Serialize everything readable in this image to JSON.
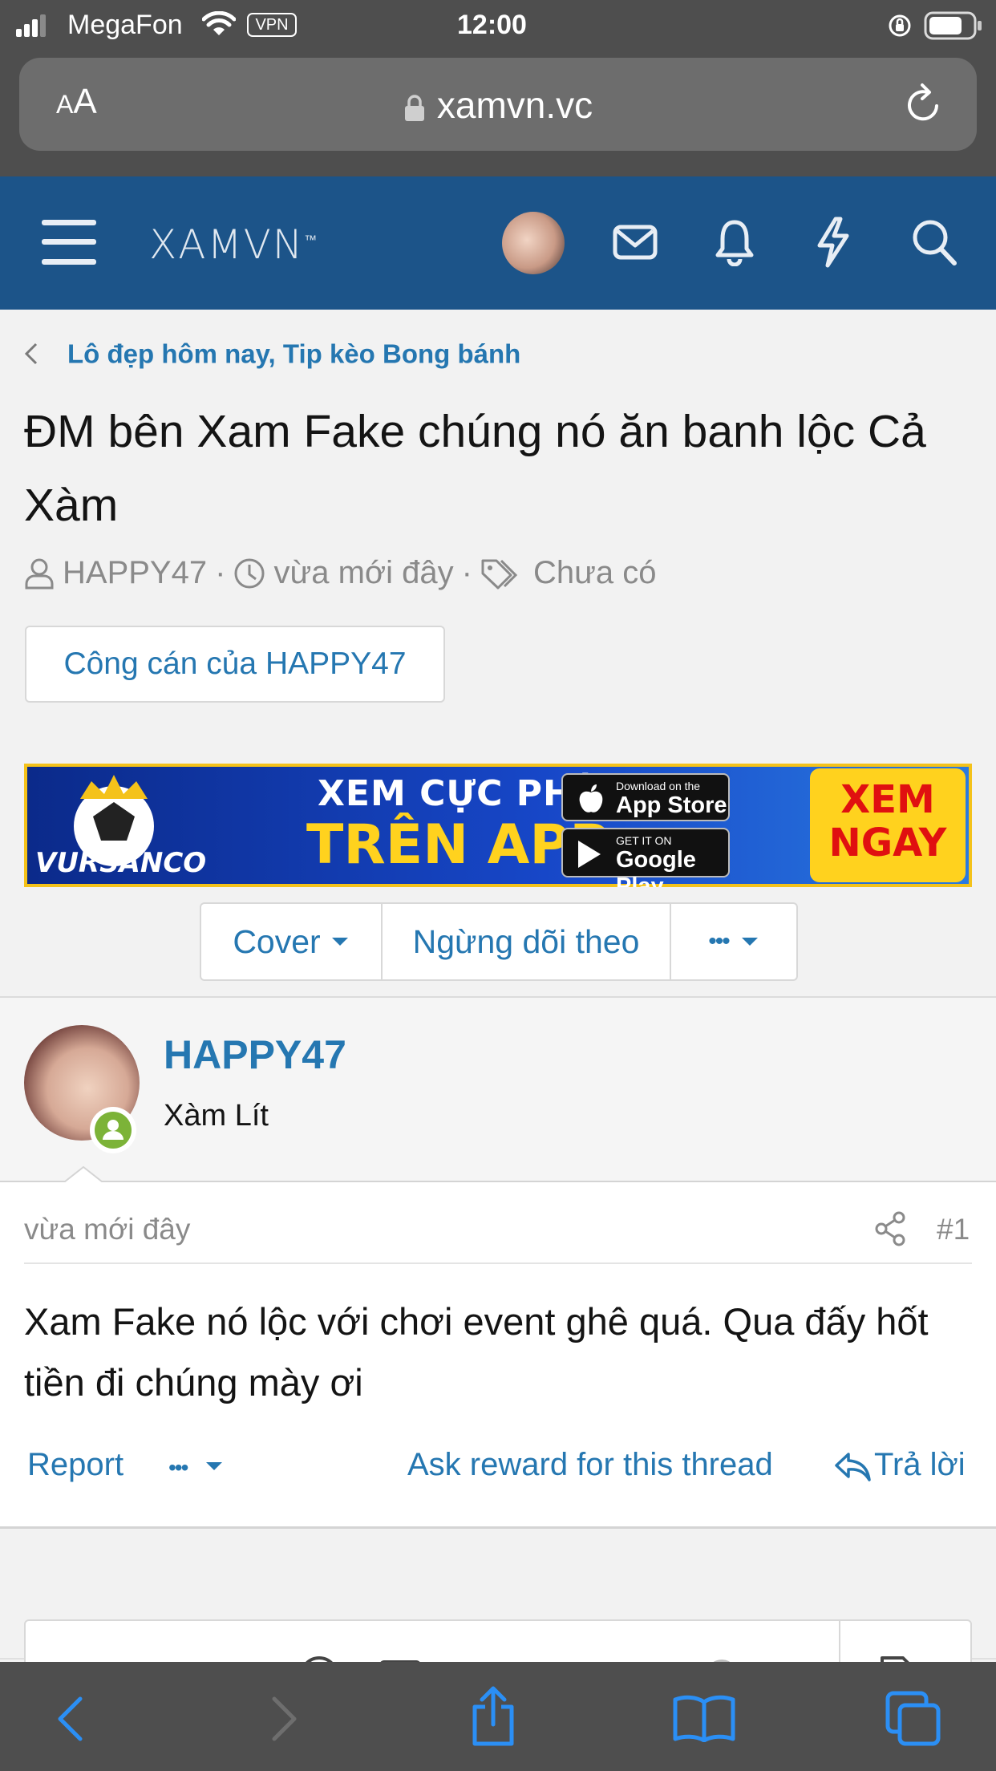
{
  "status_bar": {
    "carrier": "MegaFon",
    "vpn": "VPN",
    "time": "12:00"
  },
  "browser": {
    "text_size_label": "AA",
    "url": "xamvn.vc"
  },
  "site_header": {
    "logo": "XAMVN",
    "icons": [
      "menu-icon",
      "avatar",
      "mail-icon",
      "bell-icon",
      "lightning-icon",
      "search-icon"
    ],
    "brand_color": "#1c5489"
  },
  "breadcrumb": "Lô đẹp hôm nay, Tip kèo Bong bánh",
  "thread": {
    "title": "ĐM bên Xam Fake chúng nó ăn banh lộc Cả Xàm",
    "author": "HAPPY47",
    "time": "vừa mới đây",
    "tags": "Chưa có",
    "author_button": "Công cán của HAPPY47"
  },
  "banner": {
    "brand": "VURSANCO",
    "line1": "XEM CỰC PHÊ",
    "line2": "TRÊN APP",
    "app_store_small": "Download on the",
    "app_store": "App Store",
    "google_play_small": "GET IT ON",
    "google_play": "Google Play",
    "cta": "XEM NGAY"
  },
  "thread_actions": {
    "cover": "Cover",
    "unfollow": "Ngừng dõi theo",
    "more": "•••"
  },
  "post": {
    "username": "HAPPY47",
    "user_title": "Xàm Lít",
    "time": "vừa mới đây",
    "number": "#1",
    "message": "Xam Fake nó lộc với chơi event ghê quá. Qua đấy hốt tiền đi chúng mày ơi",
    "report": "Report",
    "more": "•••",
    "ask_reward": "Ask reward for this thread",
    "reply": "Trả lời"
  },
  "colors": {
    "link": "#2577b1",
    "online": "#7cb338",
    "safari_chrome": "#4e4e4e"
  }
}
